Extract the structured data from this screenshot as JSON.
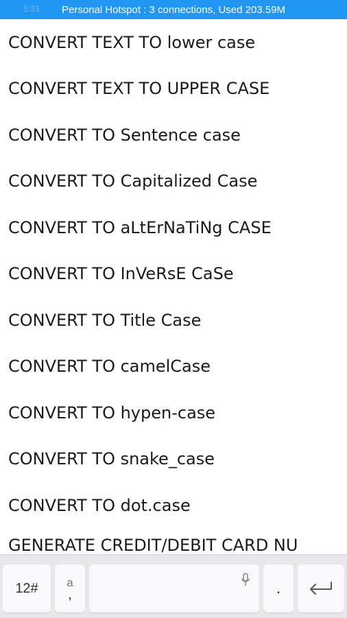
{
  "status_bar": {
    "text": "Personal Hotspot : 3 connections, Used 203.59M",
    "time_ghost": "5:33"
  },
  "menu": {
    "items": [
      {
        "label": "CONVERT TEXT TO lower case"
      },
      {
        "label": "CONVERT TEXT TO UPPER CASE"
      },
      {
        "label": "CONVERT TO Sentence case"
      },
      {
        "label": "CONVERT TO Capitalized Case"
      },
      {
        "label": "CONVERT TO aLtErNaTiNg CASE"
      },
      {
        "label": "CONVERT TO InVeRsE CaSe"
      },
      {
        "label": "CONVERT TO Title Case"
      },
      {
        "label": "CONVERT TO camelCase"
      },
      {
        "label": "CONVERT TO hypen-case"
      },
      {
        "label": "CONVERT TO snake_case"
      },
      {
        "label": "CONVERT TO dot.case"
      },
      {
        "label": "GENERATE CREDIT/DEBIT CARD NU"
      }
    ]
  },
  "keyboard": {
    "mode_key": "12#",
    "lang_key_top": "a",
    "lang_key_bottom": ",",
    "period_key": ".",
    "mic_icon": "mic-icon",
    "enter_icon": "enter-icon"
  },
  "colors": {
    "status_bar": "#2196f3",
    "text": "#1a1a1a",
    "keyboard_bg": "#e8e8ea",
    "key_bg": "#f9f9fb"
  }
}
